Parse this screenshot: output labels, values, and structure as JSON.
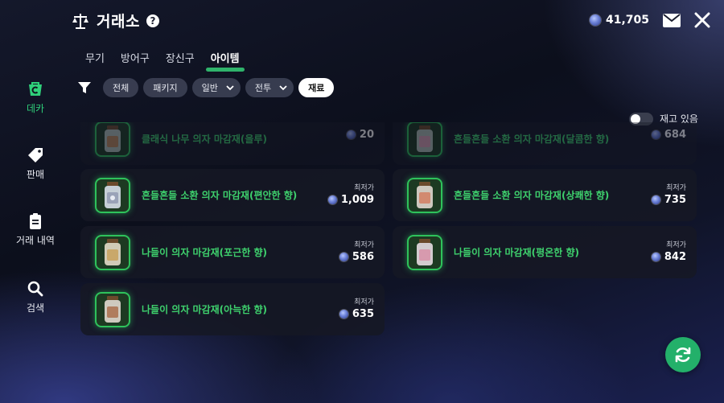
{
  "header": {
    "title": "거래소",
    "help_icon": "question-icon",
    "currency_icon": "blue-gem-coin-icon",
    "currency_amount": "41,705"
  },
  "tabs": [
    {
      "label": "무기",
      "active": false
    },
    {
      "label": "방어구",
      "active": false
    },
    {
      "label": "장신구",
      "active": false
    },
    {
      "label": "아이템",
      "active": true
    }
  ],
  "filters": {
    "all": "전체",
    "package": "패키지",
    "normal": "일반",
    "battle": "전투",
    "material": "재료",
    "selected": "재료"
  },
  "toggle": {
    "label": "재고 있음",
    "on": false
  },
  "sidenav": [
    {
      "label": "데카",
      "icon": "shopping-bag-icon",
      "active": true
    },
    {
      "label": "판매",
      "icon": "price-tag-icon",
      "active": false
    },
    {
      "label": "거래 내역",
      "icon": "clipboard-icon",
      "active": false
    },
    {
      "label": "검색",
      "icon": "search-icon",
      "active": false
    }
  ],
  "listings": {
    "price_caption": "최저가",
    "items": [
      {
        "name": "클래식 나무 의자 마감재(을루)",
        "price": "20",
        "faded": true
      },
      {
        "name": "흔들흔들 소환 의자 마감재(달콤한 향)",
        "price": "684",
        "faded": true
      },
      {
        "name": "흔들흔들 소환 의자 마감재(편안한 향)",
        "price": "1,009",
        "faded": false
      },
      {
        "name": "흔들흔들 소환 의자 마감재(상쾌한 향)",
        "price": "735",
        "faded": false
      },
      {
        "name": "나들이 의자 마감재(포근한 향)",
        "price": "586",
        "faded": false
      },
      {
        "name": "나들이 의자 마감재(평온한 향)",
        "price": "842",
        "faded": false
      },
      {
        "name": "나들이 의자 마감재(아늑한 향)",
        "price": "635",
        "faded": false
      }
    ]
  },
  "colors": {
    "accent_green": "#2fb36b",
    "item_name_green": "#3ed16d",
    "refresh_button": "#23b06a"
  }
}
